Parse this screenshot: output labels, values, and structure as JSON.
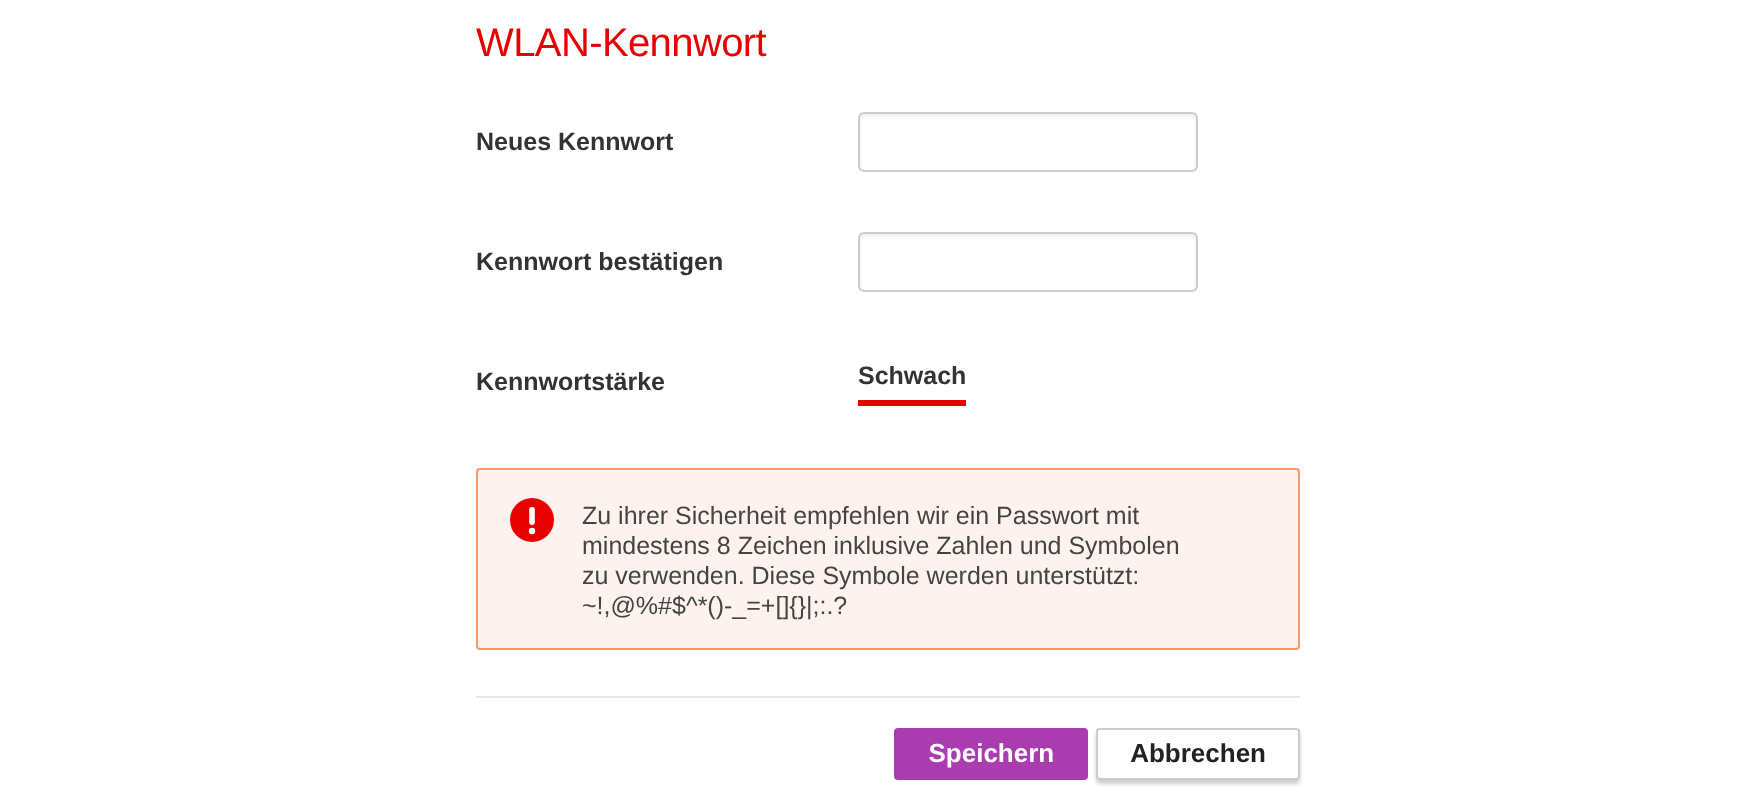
{
  "title": "WLAN-Kennwort",
  "fields": [
    {
      "label": "Neues Kennwort"
    },
    {
      "label": "Kennwort bestätigen"
    }
  ],
  "strength": {
    "label": "Kennwortstärke",
    "value": "Schwach",
    "kind": "weak"
  },
  "alert": {
    "kind": "warning",
    "lines": [
      "Zu ihrer Sicherheit empfehlen wir ein Passwort mit",
      "mindestens 8 Zeichen inklusive Zahlen und Symbolen",
      "zu verwenden. Diese Symbole werden unterstützt:",
      "~!,@%#$^*()-_=+[]{}|;:.?"
    ]
  },
  "buttons": [
    {
      "label": "Speichern",
      "kind": "primary"
    },
    {
      "label": "Abbrechen",
      "kind": "secondary"
    }
  ]
}
